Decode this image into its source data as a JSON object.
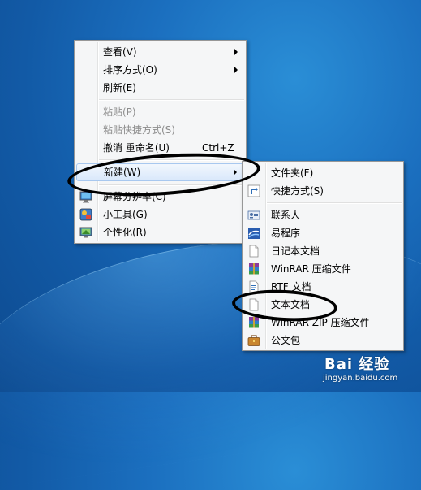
{
  "context_menu": {
    "items": [
      {
        "label": "查看(V)",
        "submenu": true
      },
      {
        "label": "排序方式(O)",
        "submenu": true
      },
      {
        "label": "刷新(E)"
      },
      {
        "label": "粘贴(P)",
        "disabled": true
      },
      {
        "label": "粘贴快捷方式(S)",
        "disabled": true
      },
      {
        "label": "撤消 重命名(U)",
        "shortcut": "Ctrl+Z"
      },
      {
        "label": "新建(W)",
        "submenu": true,
        "highlighted": true
      },
      {
        "label": "屏幕分辨率(C)",
        "icon": "display-icon"
      },
      {
        "label": "小工具(G)",
        "icon": "gadgets-icon"
      },
      {
        "label": "个性化(R)",
        "icon": "personalize-icon"
      }
    ]
  },
  "new_submenu": {
    "items": [
      {
        "label": "文件夹(F)",
        "icon": "folder-icon"
      },
      {
        "label": "快捷方式(S)",
        "icon": "shortcut-icon"
      },
      {
        "label": "联系人",
        "icon": "contact-icon"
      },
      {
        "label": "易程序",
        "icon": "app-icon"
      },
      {
        "label": "日记本文档",
        "icon": "journal-icon"
      },
      {
        "label": "WinRAR 压缩文件",
        "icon": "winrar-icon"
      },
      {
        "label": "RTF 文档",
        "icon": "rtf-icon"
      },
      {
        "label": "文本文档",
        "icon": "text-document-icon"
      },
      {
        "label": "WinRAR ZIP 压缩文件",
        "icon": "winrar-zip-icon"
      },
      {
        "label": "公文包",
        "icon": "briefcase-icon"
      }
    ]
  },
  "watermark": {
    "logo_text": "Bai 经验",
    "url": "jingyan.baidu.com"
  },
  "colors": {
    "desktop": "#1b6fbf",
    "menu_bg": "#f5f6f7",
    "highlight": "#d9e8fb"
  }
}
